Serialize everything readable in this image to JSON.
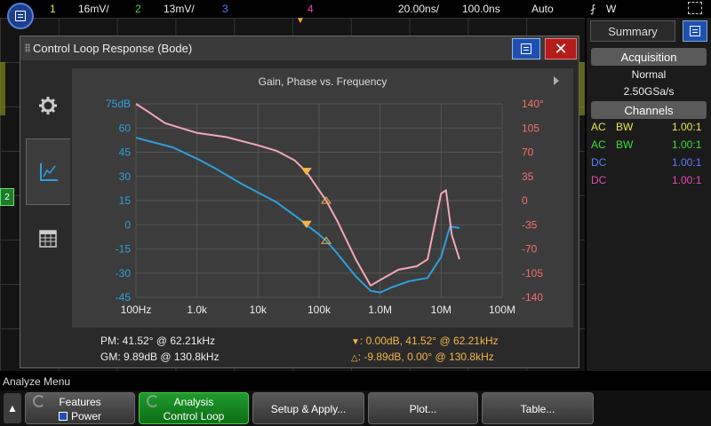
{
  "topbar": {
    "ch1_num": "1",
    "ch1_scale": "16mV/",
    "ch2_num": "2",
    "ch2_scale": "13mV/",
    "ch3_num": "3",
    "ch4_num": "4",
    "timebase": "20.00ns/",
    "delay": "100.0ns",
    "trigger_mode": "Auto",
    "trigger_source": "W",
    "colors": {
      "ch1": "#e8e84a",
      "ch2": "#3cdc3c",
      "ch3": "#5a7cff",
      "ch4": "#e64ab4"
    }
  },
  "ch2_marker": "2",
  "right_panel": {
    "tab_label": "Summary",
    "acquisition_header": "Acquisition",
    "acq_mode": "Normal",
    "sample_rate": "2.50GSa/s",
    "channels_header": "Channels",
    "channels": [
      {
        "coupling": "AC",
        "bw": "BW",
        "probe": "1.00:1",
        "color": "#e8e84a"
      },
      {
        "coupling": "AC",
        "bw": "BW",
        "probe": "1.00:1",
        "color": "#3cdc3c"
      },
      {
        "coupling": "DC",
        "bw": "",
        "probe": "1.00:1",
        "color": "#5a7cff"
      },
      {
        "coupling": "DC",
        "bw": "",
        "probe": "1.00:1",
        "color": "#e64ab4"
      }
    ]
  },
  "dialog": {
    "title": "Control Loop Response (Bode)",
    "close_label": "✕",
    "plot_title": "Gain, Phase vs. Frequency",
    "pm_text": "PM:  41.52° @ 62.21kHz",
    "gm_text": "GM:  9.89dB @ 130.8kHz",
    "marker1_text": ":  0.00dB, 41.52° @ 62.21kHz",
    "marker2_text": ":  -9.89dB, 0.00° @ 130.8kHz"
  },
  "chart_data": {
    "type": "line",
    "title": "Gain, Phase vs. Frequency",
    "x_scale": "log",
    "x_ticks": [
      "100Hz",
      "1.0k",
      "10k",
      "100k",
      "1.0M",
      "10M",
      "100M"
    ],
    "x_tick_values": [
      100,
      1000,
      10000,
      100000,
      1000000,
      10000000,
      100000000
    ],
    "y_left_ticks": [
      "75dB",
      "60",
      "45",
      "30",
      "15",
      "0",
      "-15",
      "-30",
      "-45"
    ],
    "y_left_range": [
      -45,
      75
    ],
    "y_right_ticks": [
      "140°",
      "105",
      "70",
      "35",
      "0",
      "-35",
      "-70",
      "-105",
      "-140"
    ],
    "y_right_range": [
      -140,
      140
    ],
    "grid": true,
    "series": [
      {
        "name": "Gain",
        "axis": "left",
        "color": "#2e9fdc",
        "x": [
          100,
          200,
          400,
          1000,
          2000,
          5000,
          10000,
          20000,
          50000,
          62210,
          100000,
          130800,
          200000,
          400000,
          700000,
          1000000,
          1500000,
          3000000,
          6000000,
          10000000,
          14000000,
          20000000
        ],
        "y": [
          54,
          51,
          48,
          41,
          35,
          26,
          20,
          14,
          3,
          0,
          -6,
          -9.9,
          -18,
          -32,
          -41,
          -42,
          -39,
          -35,
          -33,
          -20,
          -1,
          -2
        ]
      },
      {
        "name": "Phase",
        "axis": "right",
        "color": "#f2a7b8",
        "x": [
          100,
          150,
          300,
          700,
          1000,
          3000,
          10000,
          20000,
          40000,
          62210,
          100000,
          130800,
          200000,
          400000,
          700000,
          1000000,
          2000000,
          4000000,
          6000000,
          10000000,
          12000000,
          15000000,
          20000000
        ],
        "y": [
          140,
          130,
          112,
          102,
          98,
          92,
          80,
          72,
          58,
          41.5,
          15,
          0,
          -30,
          -85,
          -123,
          -115,
          -100,
          -95,
          -85,
          10,
          15,
          -50,
          -85
        ]
      }
    ],
    "markers": [
      {
        "label": "PM",
        "frequency": 62210,
        "gain_db": 0.0,
        "phase_deg": 41.52
      },
      {
        "label": "GM",
        "frequency": 130800,
        "gain_db": -9.89,
        "phase_deg": 0.0
      }
    ]
  },
  "bottom": {
    "menu_label": "Analyze Menu",
    "features_l1": "Features",
    "features_l2": "Power",
    "analysis_l1": "Analysis",
    "analysis_l2": "Control Loop",
    "setup_label": "Setup & Apply...",
    "plot_label": "Plot...",
    "table_label": "Table..."
  }
}
